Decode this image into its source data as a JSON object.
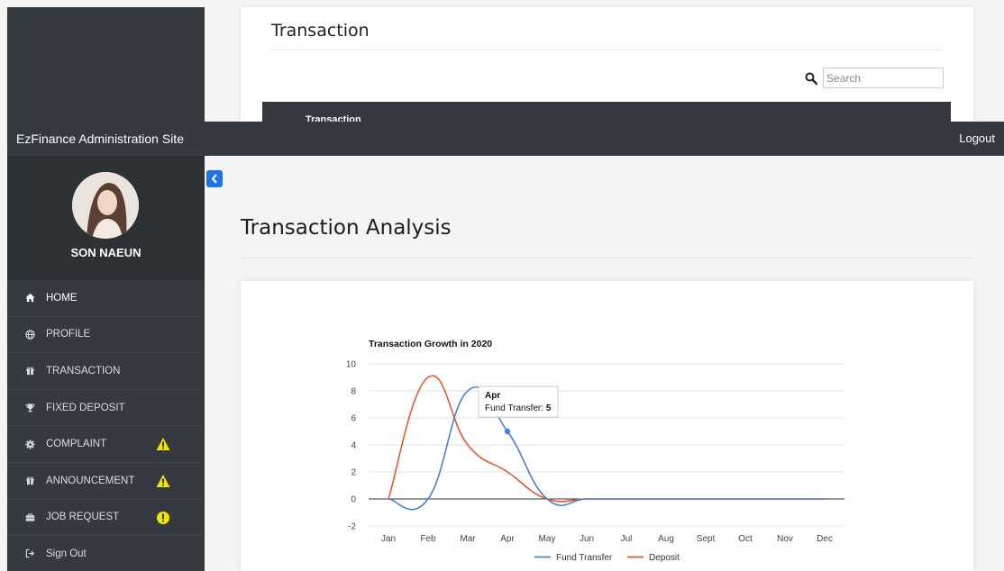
{
  "background_page": {
    "title": "Transaction",
    "search": {
      "placeholder": "Search"
    },
    "table_header": "Transaction"
  },
  "navbar": {
    "brand": "EzFinance Administration Site",
    "logout": "Logout"
  },
  "profile": {
    "name": "SON NAEUN"
  },
  "sidebar": {
    "items": [
      {
        "label": "HOME",
        "icon": "home-icon"
      },
      {
        "label": "PROFILE",
        "icon": "globe-icon"
      },
      {
        "label": "TRANSACTION",
        "icon": "gift-icon"
      },
      {
        "label": "FIXED DEPOSIT",
        "icon": "trophy-icon"
      },
      {
        "label": "COMPLAINT",
        "icon": "gear-icon",
        "badge": "warning-icon"
      },
      {
        "label": "ANNOUNCEMENT",
        "icon": "gift-icon",
        "badge": "warning-icon"
      },
      {
        "label": "JOB REQUEST",
        "icon": "briefcase-icon",
        "badge": "alert-circle-icon"
      },
      {
        "label": "Sign Out",
        "icon": "sign-out-icon"
      }
    ]
  },
  "main": {
    "title": "Transaction Analysis"
  },
  "colors": {
    "fund_transfer": "#4a7fd4",
    "deposit": "#e2582e",
    "sidebar": "#343a40",
    "badge_yellow": "#f2e600",
    "accent": "#1a73e8"
  },
  "chart_data": {
    "type": "line",
    "title": "Transaction Growth in 2020",
    "categories": [
      "Jan",
      "Feb",
      "Mar",
      "Apr",
      "May",
      "Jun",
      "Jul",
      "Aug",
      "Sept",
      "Oct",
      "Nov",
      "Dec"
    ],
    "series": [
      {
        "name": "Fund Transfer",
        "values": [
          0,
          0,
          8,
          5,
          0,
          0,
          0,
          0,
          0,
          0,
          0,
          0
        ]
      },
      {
        "name": "Deposit",
        "values": [
          0,
          9,
          4,
          2,
          0,
          0,
          0,
          0,
          0,
          0,
          0,
          0
        ]
      }
    ],
    "ylim": [
      -2,
      10
    ],
    "yticks": [
      -2,
      0,
      2,
      4,
      6,
      8,
      10
    ],
    "grid": true,
    "legend": "bottom",
    "tooltip": {
      "title": "Apr",
      "series": "Fund Transfer",
      "value": "5"
    }
  }
}
